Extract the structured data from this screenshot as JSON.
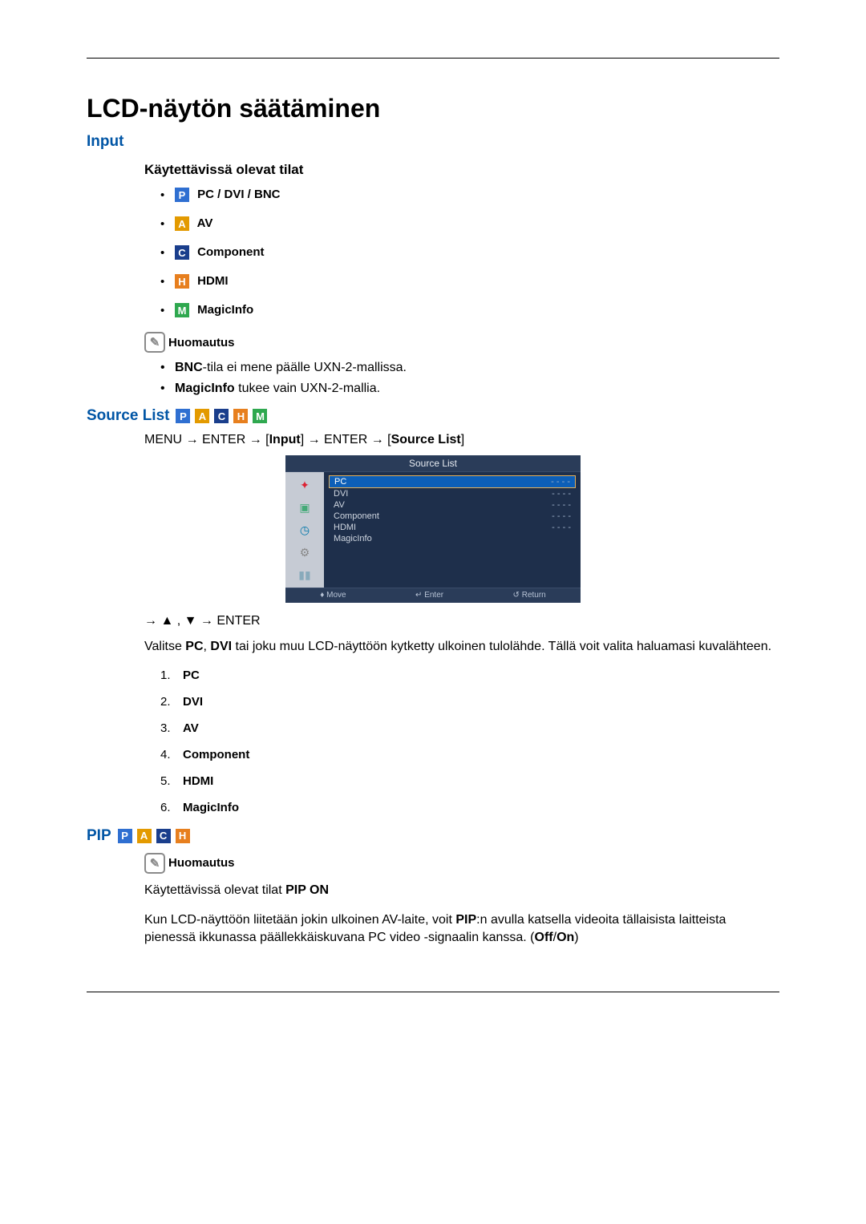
{
  "page": {
    "title": "LCD-näytön säätäminen"
  },
  "input": {
    "title": "Input",
    "modes_title": "Käytettävissä olevat tilat",
    "modes": {
      "p": "PC / DVI / BNC",
      "a": "AV",
      "c": "Component",
      "h": "HDMI",
      "m": "MagicInfo"
    },
    "note_label": "Huomautus",
    "note1_bold": "BNC",
    "note1_text": "-tila ei mene päälle UXN-2-mallissa.",
    "note2_bold": "MagicInfo",
    "note2_text": " tukee vain UXN-2-mallia."
  },
  "source": {
    "title": "Source List",
    "path": {
      "menu": "MENU",
      "arrow": "→",
      "enter": "ENTER",
      "b1": "Input",
      "b2": "Source List"
    },
    "osd": {
      "title": "Source List",
      "items": {
        "pc": "PC",
        "dvi": "DVI",
        "av": "AV",
        "component": "Component",
        "hdmi": "HDMI",
        "magicinfo": "MagicInfo"
      },
      "val_dash": "- - - -",
      "footer": {
        "move": "Move",
        "enter": "Enter",
        "return": "Return"
      }
    },
    "tri_line": "→ ▲ , ▼ → ENTER",
    "body_pre": "Valitse ",
    "body_b1": "PC",
    "body_sep": ", ",
    "body_b2": "DVI",
    "body_post": " tai joku muu LCD-näyttöön kytketty ulkoinen tulolähde. Tällä voit valita haluamasi kuvalähteen.",
    "list": {
      "i1": "PC",
      "i2": "DVI",
      "i3": "AV",
      "i4": "Component",
      "i5": "HDMI",
      "i6": "MagicInfo"
    }
  },
  "pip": {
    "title": "PIP",
    "note_label": "Huomautus",
    "line1_pre": "Käytettävissä olevat tilat ",
    "line1_bold": "PIP ON",
    "para_pre": "Kun LCD-näyttöön liitetään jokin ulkoinen AV-laite, voit ",
    "para_b1": "PIP",
    "para_mid": ":n avulla katsella videoita tällaisista laitteista pienessä ikkunassa päällekkäiskuvana PC video -signaalin kanssa. (",
    "para_b2": "Off",
    "para_slash": "/",
    "para_b3": "On",
    "para_end": ")"
  }
}
